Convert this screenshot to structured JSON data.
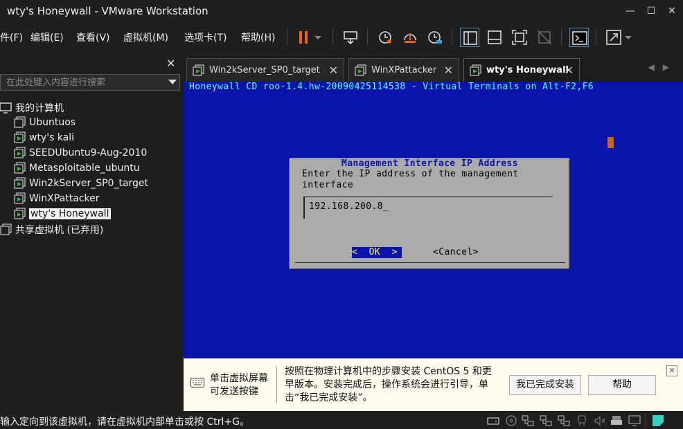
{
  "window": {
    "title": "wty's Honeywall - VMware Workstation"
  },
  "menu": [
    "件(F)",
    "编辑(E)",
    "查看(V)",
    "虚拟机(M)",
    "选项卡(T)",
    "帮助(H)"
  ],
  "library": {
    "search_placeholder": "在此处键入内容进行搜索",
    "my_computer": "我的计算机",
    "vms": [
      "Ubuntuos",
      "wty's kali",
      "SEEDUbuntu9-Aug-2010",
      "Metasploitable_ubuntu",
      "Win2kServer_SP0_target",
      "WinXPattacker",
      "wty's Honeywall"
    ],
    "selected": "wty's Honeywall",
    "shared": "共享虚拟机 (已弃用)"
  },
  "tabs": [
    {
      "label": "Win2kServer_SP0_target",
      "active": false
    },
    {
      "label": "WinXPattacker",
      "active": false
    },
    {
      "label": "wty's Honeywall",
      "active": true
    }
  ],
  "console": {
    "header": "Honeywall CD roo-1.4.hw-20090425114538 - Virtual Terminals on Alt-F2,F6",
    "dialog_title": "Management Interface IP Address",
    "dialog_text_1": "Enter the IP address of the management",
    "dialog_text_2": "interface",
    "ip_value": "192.168.200.8_",
    "ok_label": "<  OK  >",
    "cancel_label": "<Cancel>"
  },
  "hint": {
    "left_1": "单击虚拟屏幕",
    "left_2": "可发送按键",
    "main_1": "按照在物理计算机中的步骤安装 CentOS 5 和更",
    "main_2": "早版本。安装完成后，操作系统会进行引导，单",
    "main_3": "击“我已完成安装”。",
    "done_button": "我已完成安装",
    "help_button": "帮助",
    "close_glyph": "✕"
  },
  "status": {
    "text": "输入定向到该虚拟机，请在虚拟机内部单击或按 Ctrl+G。"
  },
  "colors": {
    "console_bg": "#0a14aa",
    "accent_orange": "#e8661e",
    "vm_icon_green": "#3cb043"
  }
}
